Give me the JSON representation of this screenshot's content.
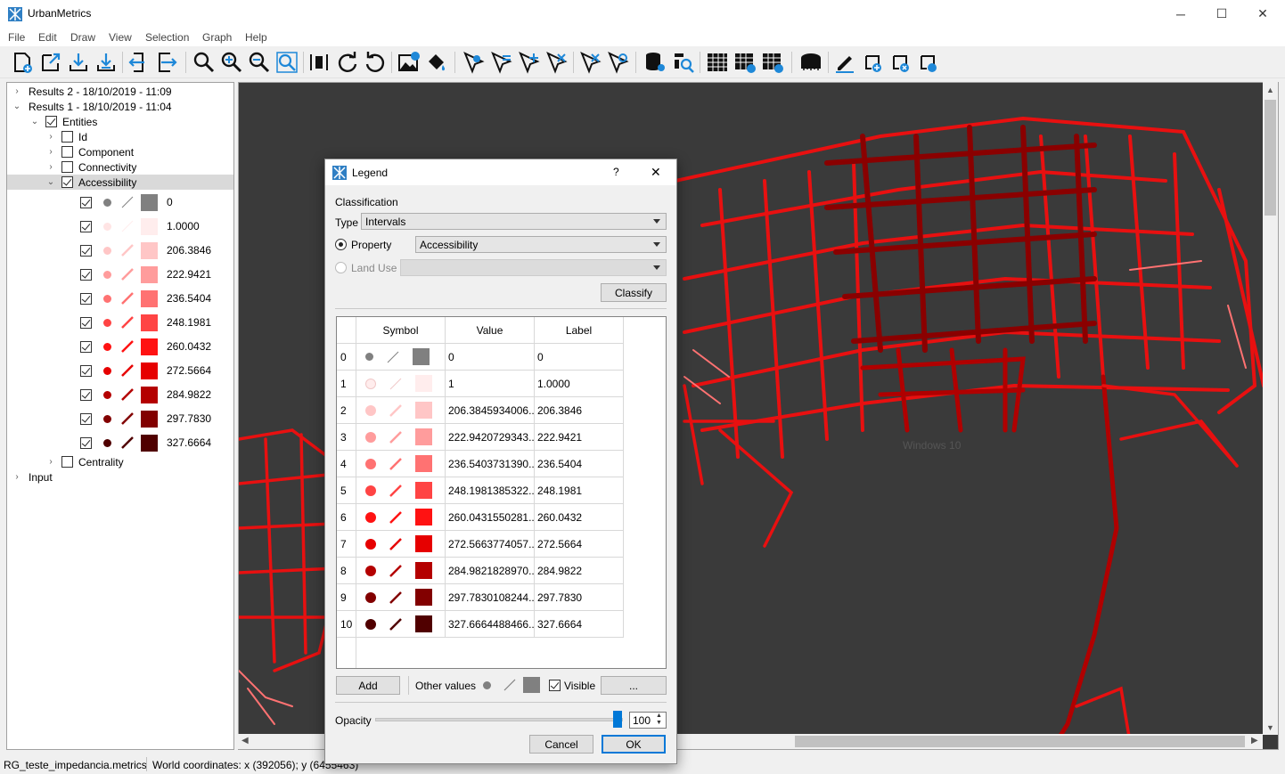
{
  "window": {
    "title": "UrbanMetrics",
    "minimize": "─",
    "maximize": "☐",
    "close": "✕"
  },
  "menu": [
    "File",
    "Edit",
    "Draw",
    "View",
    "Selection",
    "Graph",
    "Help"
  ],
  "tree": {
    "results2": "Results 2 - 18/10/2019 - 11:09",
    "results1": "Results 1 - 18/10/2019 - 11:04",
    "entities": "Entities",
    "id": "Id",
    "component": "Component",
    "connectivity": "Connectivity",
    "accessibility": "Accessibility",
    "centrality": "Centrality",
    "input": "Input",
    "legend_items": [
      {
        "label": "0",
        "color": "#808080",
        "point": "#808080"
      },
      {
        "label": "1.0000",
        "color": "#ffeded",
        "point": "#ffe4e4"
      },
      {
        "label": "206.3846",
        "color": "#ffc6c6",
        "point": "#ffc6c6"
      },
      {
        "label": "222.9421",
        "color": "#ff9c9c",
        "point": "#ff9c9c"
      },
      {
        "label": "236.5404",
        "color": "#ff7272",
        "point": "#ff7272"
      },
      {
        "label": "248.1981",
        "color": "#ff4444",
        "point": "#ff4444"
      },
      {
        "label": "260.0432",
        "color": "#ff1212",
        "point": "#ff1212"
      },
      {
        "label": "272.5664",
        "color": "#e60000",
        "point": "#e60000"
      },
      {
        "label": "284.9822",
        "color": "#b40000",
        "point": "#b40000"
      },
      {
        "label": "297.7830",
        "color": "#820000",
        "point": "#820000"
      },
      {
        "label": "327.6664",
        "color": "#500000",
        "point": "#500000"
      }
    ]
  },
  "map": {
    "watermark": "Windows 10"
  },
  "status": {
    "file": "RG_teste_impedancia.metrics",
    "coords": "World coordinates: x (392056); y (6455463)"
  },
  "legend_dialog": {
    "title": "Legend",
    "help": "?",
    "close": "✕",
    "classification": "Classification",
    "type_label": "Type",
    "type_value": "Intervals",
    "property_label": "Property",
    "property_value": "Accessibility",
    "landuse_label": "Land Use",
    "classify": "Classify",
    "columns": {
      "symbol": "Symbol",
      "value": "Value",
      "label": "Label"
    },
    "rows": [
      {
        "idx": "0",
        "value": "0",
        "label": "0",
        "color": "#808080"
      },
      {
        "idx": "1",
        "value": "1",
        "label": "1.0000",
        "color": "#ffeded"
      },
      {
        "idx": "2",
        "value": "206.3845934006...",
        "label": "206.3846",
        "color": "#ffc6c6"
      },
      {
        "idx": "3",
        "value": "222.9420729343...",
        "label": "222.9421",
        "color": "#ff9c9c"
      },
      {
        "idx": "4",
        "value": "236.5403731390...",
        "label": "236.5404",
        "color": "#ff7272"
      },
      {
        "idx": "5",
        "value": "248.1981385322...",
        "label": "248.1981",
        "color": "#ff4444"
      },
      {
        "idx": "6",
        "value": "260.0431550281...",
        "label": "260.0432",
        "color": "#ff1212"
      },
      {
        "idx": "7",
        "value": "272.5663774057...",
        "label": "272.5664",
        "color": "#e60000"
      },
      {
        "idx": "8",
        "value": "284.9821828970...",
        "label": "284.9822",
        "color": "#b40000"
      },
      {
        "idx": "9",
        "value": "297.7830108244...",
        "label": "297.7830",
        "color": "#820000"
      },
      {
        "idx": "10",
        "value": "327.6664488466...",
        "label": "327.6664",
        "color": "#500000"
      }
    ],
    "add": "Add",
    "other_values": "Other values",
    "visible": "Visible",
    "more": "...",
    "opacity_label": "Opacity",
    "opacity_value": "100",
    "cancel": "Cancel",
    "ok": "OK"
  }
}
